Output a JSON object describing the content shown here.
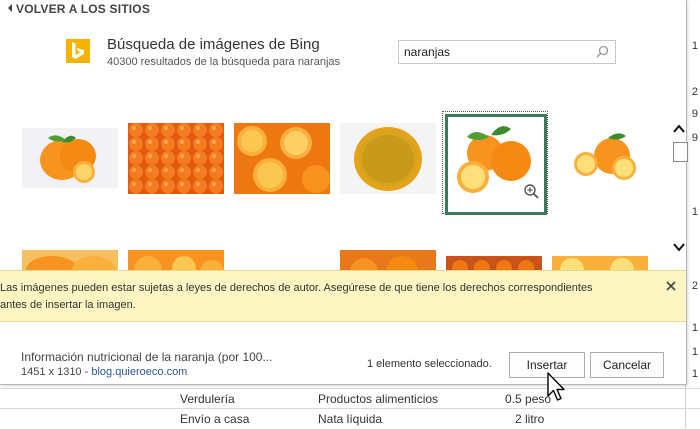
{
  "back_link": "VOLVER A LOS SITIOS",
  "header": {
    "title": "Búsqueda de imágenes de Bing",
    "subtitle": "40300 resultados de la búsqueda para naranjas"
  },
  "search": {
    "value": "naranjas"
  },
  "results": [
    {
      "name": "orange-with-leaves",
      "selected": false
    },
    {
      "name": "oranges-pile",
      "selected": false
    },
    {
      "name": "halved-oranges",
      "selected": false
    },
    {
      "name": "orange-slice",
      "selected": false
    },
    {
      "name": "oranges-with-leaves-halved",
      "selected": true
    },
    {
      "name": "orange-and-slice",
      "selected": false
    },
    {
      "name": "orange-row2-a",
      "selected": false
    },
    {
      "name": "orange-row2-b",
      "selected": false
    },
    {
      "name": "orange-row2-c",
      "selected": false
    },
    {
      "name": "orange-row2-d",
      "selected": false
    },
    {
      "name": "orange-row2-e",
      "selected": false
    }
  ],
  "notice": {
    "line1": "Las imágenes pueden estar sujetas a leyes de derechos de autor. Asegúrese de que tiene los derechos correspondientes",
    "line2": "antes de insertar la imagen."
  },
  "footer": {
    "info_title": "Información nutricional de la naranja (por 100...",
    "dimensions": "1451 x 1310 -",
    "source": "blog.quieroeco.com",
    "selection_count": "1 elemento seleccionado.",
    "insert_label": "Insertar",
    "cancel_label": "Cancelar"
  },
  "background_sheet": {
    "row1": [
      "Verdulería",
      "Productos alimenticios",
      "0.5 peso"
    ],
    "row2": [
      "Envío a casa",
      "Nata líquida",
      "2 litro"
    ],
    "right_col": [
      "1",
      "2",
      "9",
      "9",
      "1",
      "2",
      "1",
      "1",
      "1",
      "1",
      "1"
    ]
  },
  "colors": {
    "bing_logo": "#f4b400",
    "selection_border": "#3c7a5a",
    "notice_bg": "#fdf5c2",
    "link": "#2b5797"
  }
}
